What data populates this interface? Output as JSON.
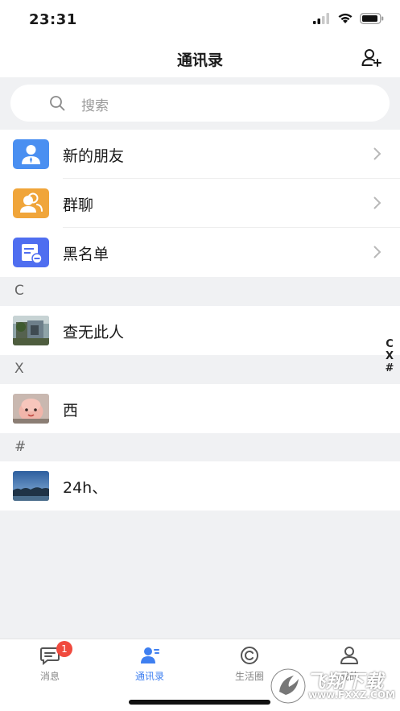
{
  "status_bar": {
    "time": "23:31"
  },
  "nav": {
    "title": "通讯录"
  },
  "search": {
    "placeholder": "搜索"
  },
  "functions": [
    {
      "label": "新的朋友",
      "color": "#4a8ff1",
      "icon": "person-icon"
    },
    {
      "label": "群聊",
      "color": "#f0a53a",
      "icon": "group-icon"
    },
    {
      "label": "黑名单",
      "color": "#4f6ef0",
      "icon": "blacklist-icon"
    }
  ],
  "sections": [
    {
      "letter": "C",
      "contacts": [
        {
          "name": "查无此人"
        }
      ]
    },
    {
      "letter": "X",
      "contacts": [
        {
          "name": "西"
        }
      ]
    },
    {
      "letter": "#",
      "contacts": [
        {
          "name": "24h、"
        }
      ]
    }
  ],
  "index_bar": [
    "C",
    "X",
    "#"
  ],
  "tabs": [
    {
      "label": "消息",
      "badge": "1",
      "icon": "message-icon"
    },
    {
      "label": "通讯录",
      "active": true,
      "icon": "contacts-icon"
    },
    {
      "label": "生活圈",
      "icon": "life-circle-icon"
    },
    {
      "label": "我的",
      "icon": "profile-icon"
    }
  ],
  "watermark": {
    "title": "飞翔下载",
    "site": "www.FXXZ.COM"
  },
  "colors": {
    "accent": "#3e7ff0",
    "badge": "#f04a3e",
    "background": "#f0f1f3"
  }
}
